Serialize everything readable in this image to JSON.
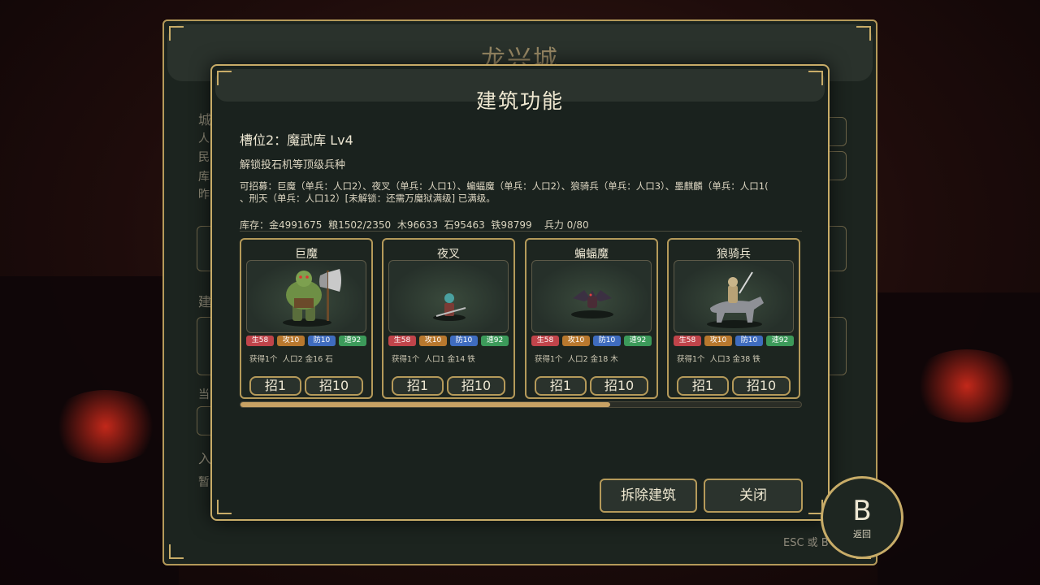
{
  "colors": {
    "gold": "#c8ac68",
    "panel": "#1a221e",
    "hp": "#c0444a",
    "atk": "#b8782e",
    "def": "#3f6cbf",
    "spd": "#3c9a5a",
    "scroll": "#c8a264"
  },
  "background_panel": {
    "title": "龙兴城",
    "fragments": [
      "城",
      "人",
      "民",
      "库",
      "昨",
      "建",
      "当",
      "入",
      "暂"
    ],
    "esc_hint": "ESC 或 B"
  },
  "modal": {
    "title": "建筑功能",
    "slot_title": "槽位2：魔武库 Lv4",
    "unlock": "解锁投石机等顶级兵种",
    "recruitable": "可招募：巨魔（单兵：人口2）、夜叉（单兵：人口1）、蝙蝠魔（单兵：人口2）、狼骑兵（单兵：人口3）、墨麒麟（单兵：人口1(\n、刑天（单兵：人口12）[未解锁：还需万魔狱满级] 已满级。",
    "stock": "库存：金4991675  粮1502/2350  木96633  石95463  铁98799    兵力 0/80",
    "scroll_progress": 0.66,
    "units": [
      {
        "name": "巨魔",
        "icon": "troll-axe-icon",
        "hp": "生58",
        "atk": "攻10",
        "def": "防10",
        "spd": "速92",
        "cost": "获得1个  人口2 金16 石",
        "btn1": "招1",
        "btn10": "招10"
      },
      {
        "name": "夜叉",
        "icon": "yaksha-spear-icon",
        "hp": "生58",
        "atk": "攻10",
        "def": "防10",
        "spd": "速92",
        "cost": "获得1个  人口1 金14 铁",
        "btn1": "招1",
        "btn10": "招10"
      },
      {
        "name": "蝙蝠魔",
        "icon": "bat-demon-icon",
        "hp": "生58",
        "atk": "攻10",
        "def": "防10",
        "spd": "速92",
        "cost": "获得1个  人口2 金18 木",
        "btn1": "招1",
        "btn10": "招10"
      },
      {
        "name": "狼骑兵",
        "icon": "wolf-rider-icon",
        "hp": "生58",
        "atk": "攻10",
        "def": "防10",
        "spd": "速92",
        "cost": "获得1个  人口3 金38 铁",
        "btn1": "招1",
        "btn10": "招10"
      }
    ],
    "demolish_label": "拆除建筑",
    "close_label": "关闭"
  },
  "b_button": {
    "letter": "B",
    "label": "返回"
  }
}
